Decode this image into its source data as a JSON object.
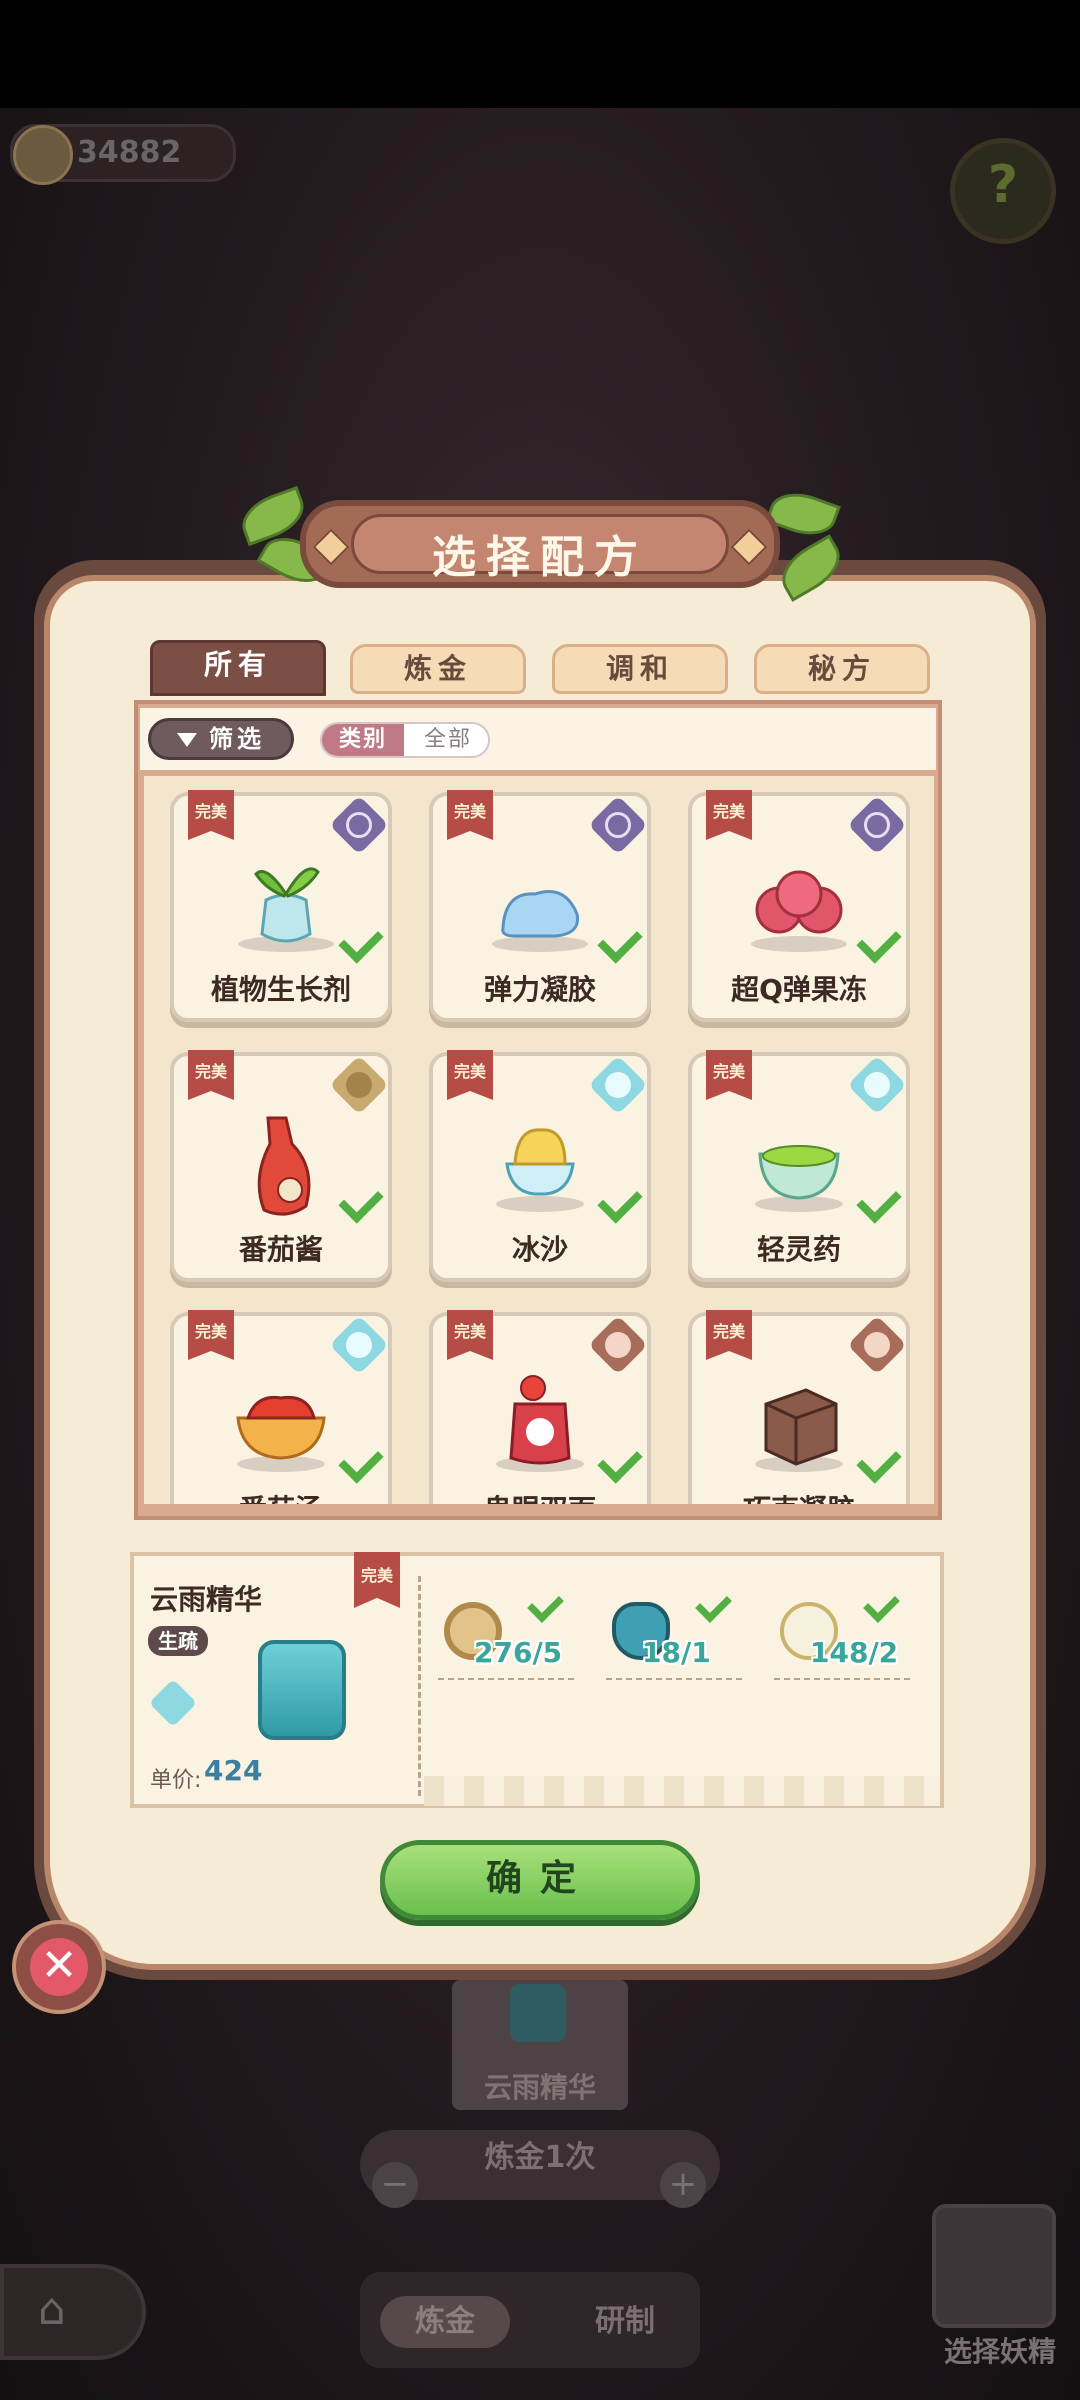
{
  "hud": {
    "coins": "34882",
    "help_icon": "?"
  },
  "dialog": {
    "title": "选择配方",
    "tabs": [
      {
        "label": "所有",
        "active": true
      },
      {
        "label": "炼金",
        "active": false
      },
      {
        "label": "调和",
        "active": false
      },
      {
        "label": "秘方",
        "active": false
      }
    ],
    "filter": {
      "button_label": "筛选",
      "category_label": "类别",
      "category_value": "全部"
    },
    "recipes": [
      {
        "name": "植物生长剂",
        "tag": "完美",
        "badge": "sc"
      },
      {
        "name": "弹力凝胶",
        "tag": "完美",
        "badge": "sc"
      },
      {
        "name": "超Q弹果冻",
        "tag": "完美",
        "badge": "sc"
      },
      {
        "name": "番茄酱",
        "tag": "完美",
        "badge": "gold"
      },
      {
        "name": "冰沙",
        "tag": "完美",
        "badge": "cyan"
      },
      {
        "name": "轻灵药",
        "tag": "完美",
        "badge": "cyan"
      },
      {
        "name": "番茄汤",
        "tag": "完美",
        "badge": "cyan"
      },
      {
        "name": "鬼眼双面",
        "tag": "完美",
        "badge": "copper"
      },
      {
        "name": "巧克凝胶",
        "tag": "完美",
        "badge": "copper"
      }
    ],
    "selected": {
      "name": "云雨精华",
      "tag": "完美",
      "skill": "生疏",
      "price_label": "单价:",
      "price": "424",
      "ingredients": [
        {
          "count": "276/5",
          "icon": "ring-ingredient-icon"
        },
        {
          "count": "18/1",
          "icon": "eggplant-ingredient-icon"
        },
        {
          "count": "148/2",
          "icon": "flower-ingredient-icon"
        }
      ]
    },
    "confirm_label": "确定",
    "close_icon": "✕"
  },
  "background": {
    "card_name": "云雨精华",
    "alchemy_count": "炼金1次",
    "minus": "−",
    "plus": "+",
    "home_icon": "⌂",
    "tab_alchemy": "炼金",
    "tab_research": "研制",
    "select_fairy": "选择妖精"
  }
}
